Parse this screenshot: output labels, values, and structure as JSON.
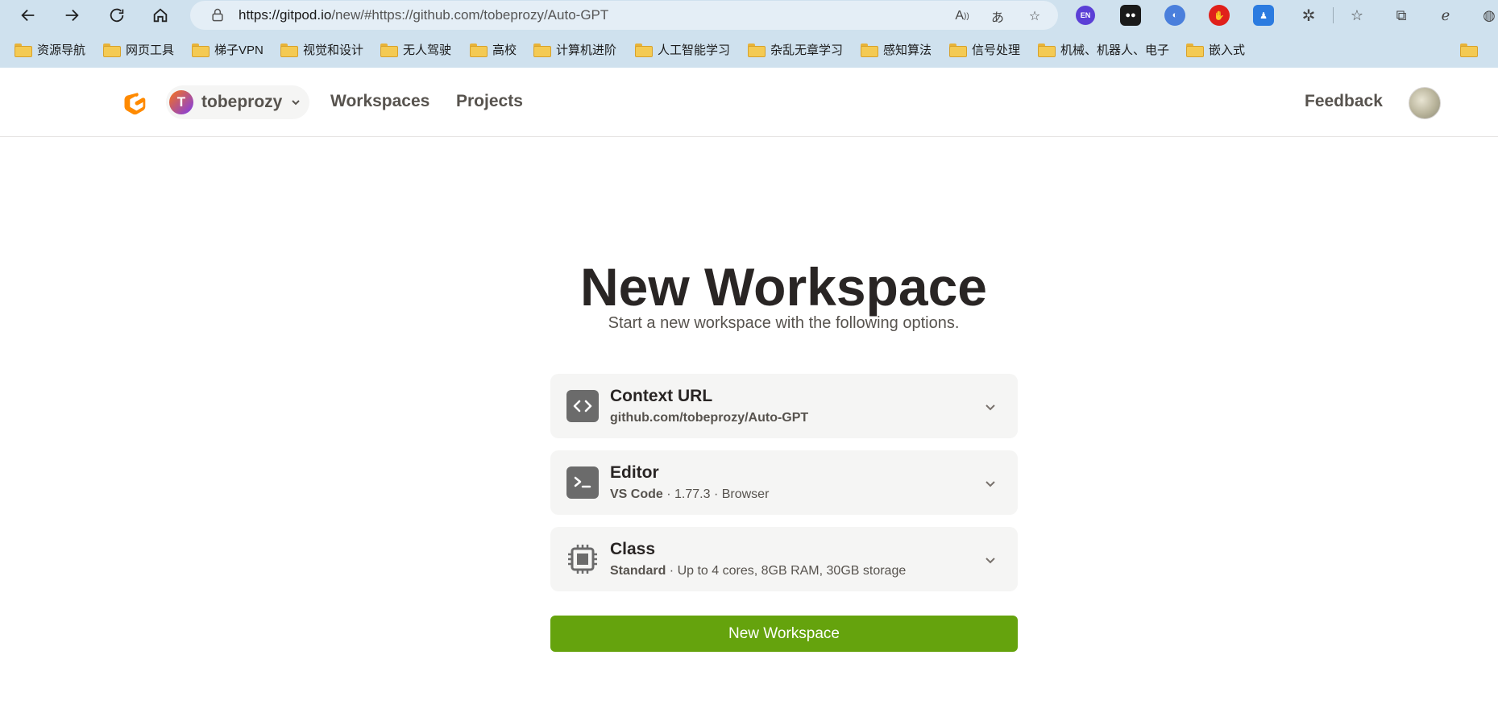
{
  "browser": {
    "url_host": "https://gitpod.io",
    "url_rest": "/new/#https://github.com/tobeprozy/Auto-GPT",
    "extensions": [
      {
        "name": "en-translate-extension",
        "label": "EN",
        "color": "#5b3fd6"
      },
      {
        "name": "dual-circle-extension",
        "label": "",
        "color": "#1a1a1a"
      },
      {
        "name": "gradient-extension",
        "label": "",
        "color": "#4a7fdc"
      },
      {
        "name": "adblock-extension",
        "label": "",
        "color": "#e0201b"
      },
      {
        "name": "person-extension",
        "label": "",
        "color": "#2b7be0"
      }
    ],
    "bookmarks": [
      "资源导航",
      "网页工具",
      "梯子VPN",
      "视觉和设计",
      "无人驾驶",
      "高校",
      "计算机进阶",
      "人工智能学习",
      "杂乱无章学习",
      "感知算法",
      "信号处理",
      "机械、机器人、电子",
      "嵌入式"
    ]
  },
  "header": {
    "org_initial": "T",
    "org_name": "tobeprozy",
    "nav": [
      "Workspaces",
      "Projects"
    ],
    "feedback": "Feedback"
  },
  "main": {
    "title": "New Workspace",
    "subtitle": "Start a new workspace with the following options.",
    "options": [
      {
        "title": "Context URL",
        "sub_bold": "github.com/tobeprozy/Auto-GPT",
        "sub_rest": ""
      },
      {
        "title": "Editor",
        "sub_bold": "VS Code",
        "sub_rest": " · 1.77.3 · Browser"
      },
      {
        "title": "Class",
        "sub_bold": "Standard",
        "sub_rest": " · Up to 4 cores, 8GB RAM, 30GB storage"
      }
    ],
    "submit_label": "New Workspace"
  },
  "colors": {
    "accent": "#65a30d",
    "chrome": "#cfe1ee",
    "card": "#f5f5f4"
  }
}
